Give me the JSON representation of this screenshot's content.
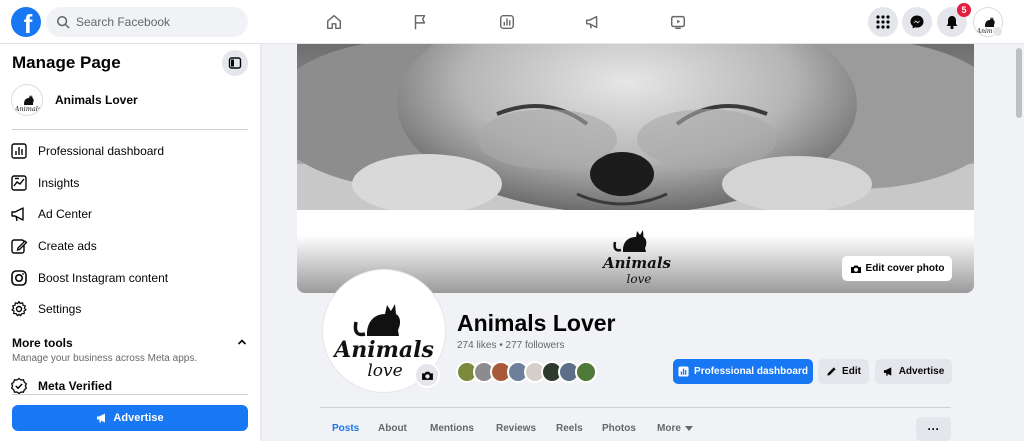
{
  "topbar": {
    "logo_letter": "f",
    "search_placeholder": "Search Facebook",
    "notification_count": "5"
  },
  "sidebar": {
    "title": "Manage Page",
    "page_name": "Animals Lover",
    "items": [
      {
        "label": "Professional dashboard",
        "icon": "dashboard-icon"
      },
      {
        "label": "Insights",
        "icon": "insights-icon"
      },
      {
        "label": "Ad Center",
        "icon": "megaphone-icon"
      },
      {
        "label": "Create ads",
        "icon": "pencil-icon"
      },
      {
        "label": "Boost Instagram content",
        "icon": "instagram-icon"
      },
      {
        "label": "Settings",
        "icon": "gear-icon"
      }
    ],
    "more_tools_title": "More tools",
    "more_tools_subtitle": "Manage your business across Meta apps.",
    "meta_verified": "Meta Verified",
    "advertise_label": "Advertise"
  },
  "cover": {
    "edit_label": "Edit cover photo"
  },
  "profile": {
    "name": "Animals Lover",
    "stats": "274 likes • 277 followers",
    "follower_colors": [
      "#7b8a3c",
      "#8c8c8c",
      "#a65a3a",
      "#6d7f9a",
      "#d6cfc9",
      "#2f3b2c",
      "#5c6e88",
      "#4f7a3a"
    ]
  },
  "actions": {
    "professional_dashboard": "Professional dashboard",
    "edit": "Edit",
    "advertise": "Advertise"
  },
  "tabs": {
    "posts": "Posts",
    "about": "About",
    "mentions": "Mentions",
    "reviews": "Reviews",
    "reels": "Reels",
    "photos": "Photos",
    "more": "More",
    "dots": "···"
  },
  "colors": {
    "brand": "#1877f2",
    "badge": "#e41e3f"
  }
}
